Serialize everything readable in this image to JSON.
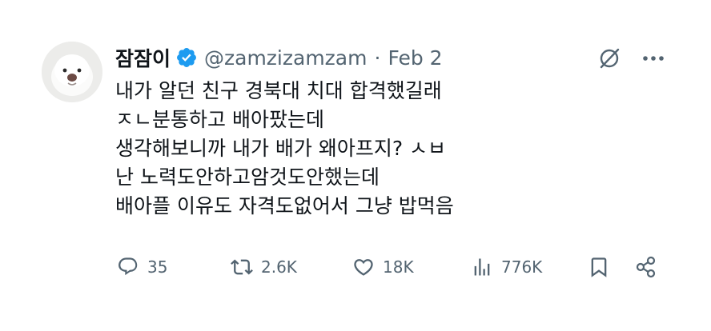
{
  "tweet": {
    "author": {
      "display_name": "잠잠이",
      "handle": "@zamzizamzam",
      "verified": true,
      "verified_color": "#1d9bf0"
    },
    "separator": "·",
    "date": "Feb 2",
    "text_lines": [
      "내가 알던 친구 경북대 치대 합격했길래",
      "ㅈㄴ분통하고 배아팠는데",
      "생각해보니까 내가 배가 왜아프지? ㅅㅂ",
      "난 노력도안하고암것도안했는데",
      "배아플 이유도 자격도없어서 그냥 밥먹음"
    ],
    "actions": {
      "replies": "35",
      "retweets": "2.6K",
      "likes": "18K",
      "views": "776K"
    },
    "icons": {
      "grok": "grok-slash-icon",
      "more": "more-dots-icon",
      "reply": "reply-icon",
      "retweet": "retweet-icon",
      "like": "heart-icon",
      "views": "views-chart-icon",
      "bookmark": "bookmark-icon",
      "share": "share-icon"
    },
    "colors": {
      "text": "#0f1419",
      "secondary": "#536471",
      "background": "#ffffff"
    }
  }
}
